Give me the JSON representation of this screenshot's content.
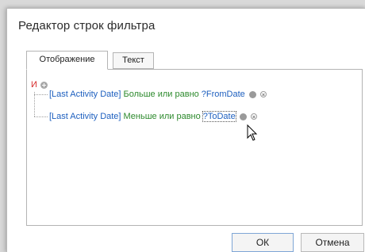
{
  "dialog": {
    "title": "Редактор строк фильтра"
  },
  "tabs": [
    {
      "label": "Отображение",
      "active": true
    },
    {
      "label": "Текст",
      "active": false
    }
  ],
  "filter": {
    "group_operator": "И",
    "conditions": [
      {
        "field": "[Last Activity Date]",
        "operator": "Больше или равно",
        "value": "?FromDate"
      },
      {
        "field": "[Last Activity Date]",
        "operator": "Меньше или равно",
        "value": "?ToDate"
      }
    ]
  },
  "buttons": {
    "ok_label": "ОК",
    "cancel_label": "Отмена"
  },
  "colors": {
    "group_operator": "#d62a2a",
    "field": "#1d5fbf",
    "operator": "#2d8a2d",
    "value": "#1d5fbf"
  },
  "icons": {
    "add_condition": "plus-circle-icon",
    "condition_action": "gear-circle-icon",
    "remove_condition": "close-circle-icon"
  }
}
